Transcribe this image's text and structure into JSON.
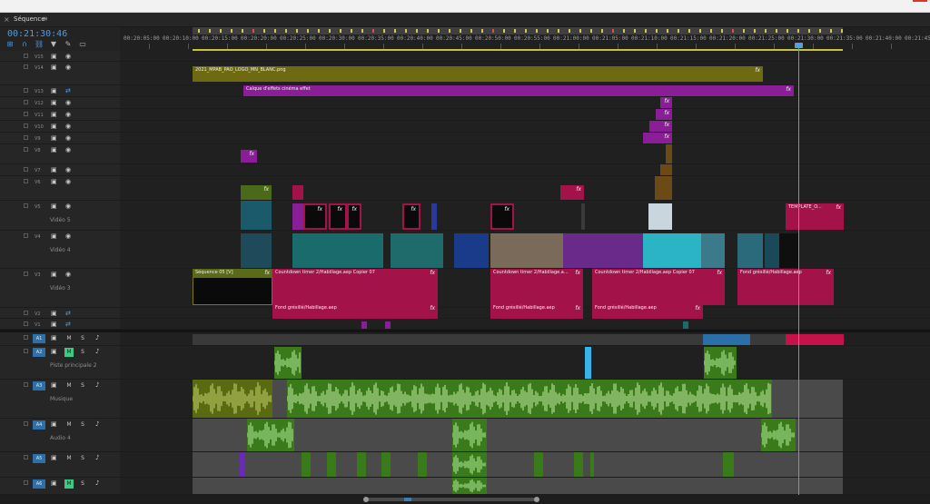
{
  "window": {
    "top_bar": ""
  },
  "panel": {
    "title": "Séquence",
    "close_glyph": "×",
    "menu_glyph": "≡"
  },
  "timecode": "00:21:30:46",
  "ruler": {
    "labels": [
      "00:20:05:00",
      "00:20:10:00",
      "00:20:15:00",
      "00:20:20:00",
      "00:20:25:00",
      "00:20:30:00",
      "00:20:35:00",
      "00:20:40:00",
      "00:20:45:00",
      "00:20:50:00",
      "00:20:55:00",
      "00:21:00:00",
      "00:21:05:00",
      "00:21:10:00",
      "00:21:15:00",
      "00:21:20:00",
      "00:21:25:00",
      "00:21:30:00",
      "00:21:35:00",
      "00:21:40:00",
      "00:21:45:00"
    ]
  },
  "video_tracks": [
    {
      "id": "V15",
      "label": "",
      "sync": false
    },
    {
      "id": "V14",
      "label": "",
      "sync": false
    },
    {
      "id": "V13",
      "label": "",
      "sync": true
    },
    {
      "id": "V12",
      "label": "",
      "sync": false
    },
    {
      "id": "V11",
      "label": "",
      "sync": false
    },
    {
      "id": "V10",
      "label": "",
      "sync": false
    },
    {
      "id": "V9",
      "label": "",
      "sync": false
    },
    {
      "id": "V8",
      "label": "",
      "sync": false
    },
    {
      "id": "V7",
      "label": "",
      "sync": false
    },
    {
      "id": "V6",
      "label": "",
      "sync": false
    },
    {
      "id": "V5",
      "label": "Vidéo 5",
      "sync": false
    },
    {
      "id": "V4",
      "label": "Vidéo 4",
      "sync": false
    },
    {
      "id": "V3",
      "label": "Vidéo 3",
      "sync": false
    },
    {
      "id": "V2",
      "label": "",
      "sync": true
    },
    {
      "id": "V1",
      "label": "",
      "sync": true
    }
  ],
  "audio_tracks": [
    {
      "id": "A1",
      "label": "",
      "solo_on": false
    },
    {
      "id": "A2",
      "label": "Piste principale 2",
      "solo_on": true
    },
    {
      "id": "A3",
      "label": "Musique",
      "solo_on": false
    },
    {
      "id": "A4",
      "label": "Audio 4",
      "solo_on": false
    },
    {
      "id": "A5",
      "label": "",
      "solo_on": false
    },
    {
      "id": "A6",
      "label": "",
      "solo_on": true
    }
  ],
  "clip_names": {
    "logo": "2021_MPAB_PAO_LOGO_MN_BLANC.png",
    "calque": "Calque d'effets cinéma effet",
    "template": "TEMPLATE_O...",
    "sequence05": "Séquence 05 [V]",
    "countdown1": "Countdown timer 2/Habillage.aep Copier 07",
    "countdown2": "Countdown timer 2/Habillage.a...",
    "countdown3": "Countdown timer 2/Habillage.aep Copier 07",
    "fond1": "Fond grésillé/Habillage.aep",
    "fond2": "Fond grésillé/Habillage.aep",
    "fond3": "Fond grésillé/Habillage.aep",
    "fond4": "Fond grésillé/Habillage.aep",
    "fx": "fx"
  },
  "track_buttons": {
    "mute": "M",
    "solo": "S"
  },
  "colors": {
    "olive": "#7a7518",
    "purple": "#8a1e96",
    "magenta": "#a4124a",
    "teal": "#1a6b6b",
    "audio_green": "#3a7a1a",
    "playhead": "#5a9ce0"
  }
}
